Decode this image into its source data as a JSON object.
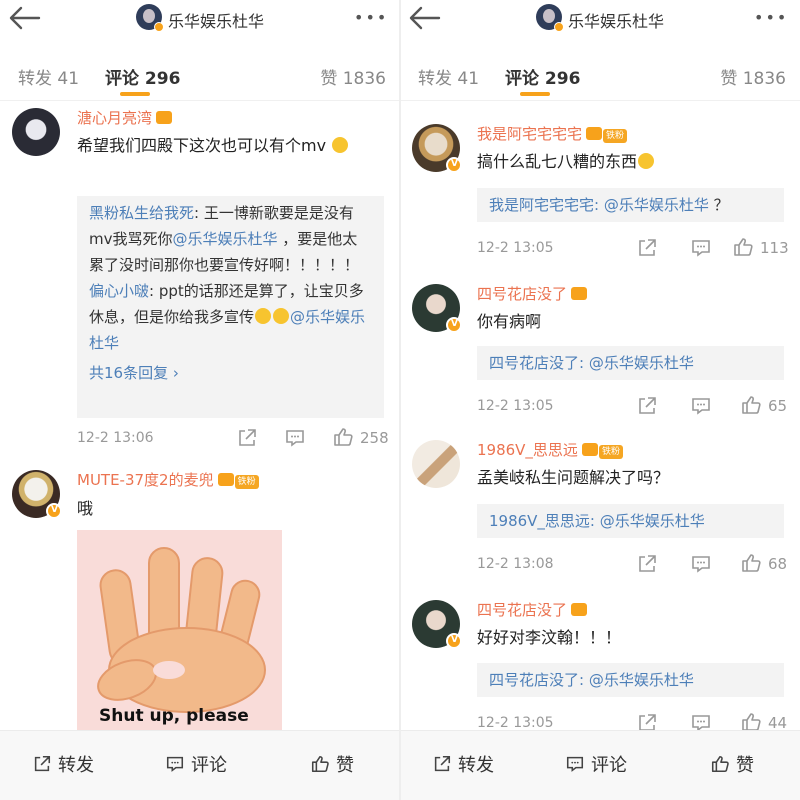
{
  "header": {
    "title": "乐华娱乐杜华"
  },
  "tabs": {
    "reposts": "转发 41",
    "comments": "评论 296",
    "likes": "赞 1836"
  },
  "bottom_bar": {
    "repost": "转发",
    "comment": "评论",
    "like": "赞"
  },
  "icons": [
    "back-arrow-icon",
    "more-icon",
    "share-icon",
    "comment-icon",
    "like-icon",
    "crown-icon",
    "verified-badge-icon"
  ],
  "colors": {
    "accent": "#f7a21b",
    "username": "#eb7350",
    "link": "#4d7fb8"
  },
  "left": {
    "c1": {
      "user": "溏心月亮湾",
      "text": "希望我们四殿下这次也可以有个mv",
      "r1_user": "黑粉私生给我死",
      "r1_text": ": 王一博新歌要是是没有mv我骂死你",
      "r1_mention": "@乐华娱乐杜华",
      "r1_text2": " ，要是他太累了没时间那你也要宣传好啊！！！！！",
      "r2_user": "偏心小啵",
      "r2_text": ": ppt的话那还是算了，让宝贝多休息，但是你给我多宣传",
      "r2_mention": "@乐华娱乐杜华",
      "more": "共16条回复 ›",
      "time": "12-2 13:06",
      "likes": "258"
    },
    "c2": {
      "user": "MUTE-37度2的麦兜",
      "fan_tag": "铁粉",
      "text": "哦",
      "sticker_text": "Shut up, please"
    }
  },
  "right": {
    "c1": {
      "user": "我是阿宅宅宅宅",
      "fan_tag": "铁粉",
      "text": "搞什么乱七八糟的东西",
      "quote_user": "我是阿宅宅宅宅:",
      "quote_mention": "@乐华娱乐杜华",
      "quote_tail": "？",
      "time": "12-2 13:05",
      "likes": "113"
    },
    "c2": {
      "user": "四号花店没了",
      "text": "你有病啊",
      "quote_user": "四号花店没了:",
      "quote_mention": "@乐华娱乐杜华",
      "time": "12-2 13:05",
      "likes": "65"
    },
    "c3": {
      "user": "1986V_思思远",
      "fan_tag": "铁粉",
      "text": "孟美岐私生问题解决了吗？",
      "quote_user": "1986V_思思远:",
      "quote_mention": "@乐华娱乐杜华",
      "time": "12-2 13:08",
      "likes": "68"
    },
    "c4": {
      "user": "四号花店没了",
      "text": "好好对李汶翰！！！",
      "quote_user": "四号花店没了:",
      "quote_mention": "@乐华娱乐杜华",
      "time": "12-2 13:05",
      "likes": "44"
    }
  }
}
